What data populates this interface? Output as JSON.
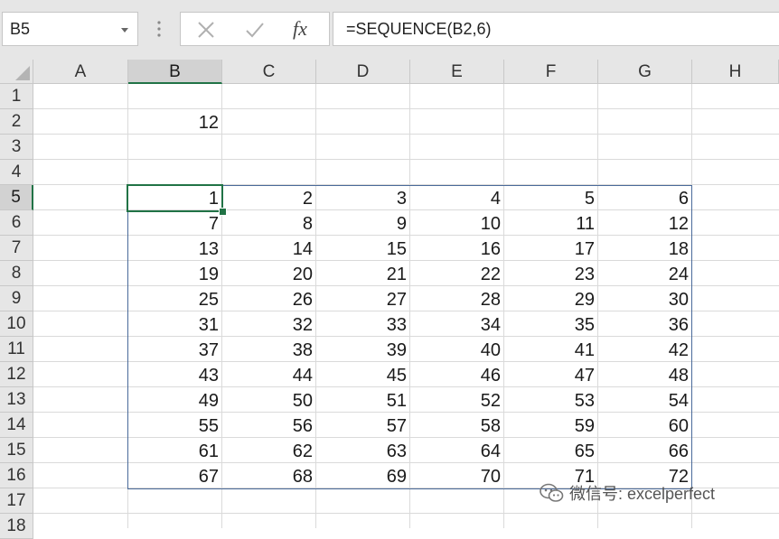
{
  "toolbar": {
    "name_box": "B5",
    "cancel_icon": "x-icon",
    "enter_icon": "check-icon",
    "fx_label": "fx",
    "formula": "=SEQUENCE(B2,6)"
  },
  "grid": {
    "columns": [
      "A",
      "B",
      "C",
      "D",
      "E",
      "F",
      "G",
      "H"
    ],
    "rows": [
      "1",
      "2",
      "3",
      "4",
      "5",
      "6",
      "7",
      "8",
      "9",
      "10",
      "11",
      "12",
      "13",
      "14",
      "15",
      "16",
      "17",
      "18"
    ],
    "selected_column": "B",
    "selected_row": "5",
    "b2_value": "12",
    "spill_values": [
      [
        "1",
        "2",
        "3",
        "4",
        "5",
        "6"
      ],
      [
        "7",
        "8",
        "9",
        "10",
        "11",
        "12"
      ],
      [
        "13",
        "14",
        "15",
        "16",
        "17",
        "18"
      ],
      [
        "19",
        "20",
        "21",
        "22",
        "23",
        "24"
      ],
      [
        "25",
        "26",
        "27",
        "28",
        "29",
        "30"
      ],
      [
        "31",
        "32",
        "33",
        "34",
        "35",
        "36"
      ],
      [
        "37",
        "38",
        "39",
        "40",
        "41",
        "42"
      ],
      [
        "43",
        "44",
        "45",
        "46",
        "47",
        "48"
      ],
      [
        "49",
        "50",
        "51",
        "52",
        "53",
        "54"
      ],
      [
        "55",
        "56",
        "57",
        "58",
        "59",
        "60"
      ],
      [
        "61",
        "62",
        "63",
        "64",
        "65",
        "66"
      ],
      [
        "67",
        "68",
        "69",
        "70",
        "71",
        "72"
      ]
    ]
  },
  "watermark": {
    "text": "微信号: excelperfect",
    "icon": "wechat-icon"
  },
  "colors": {
    "accent": "#217346",
    "spill_border": "#4a6a9a",
    "header_bg": "#e6e6e6"
  }
}
